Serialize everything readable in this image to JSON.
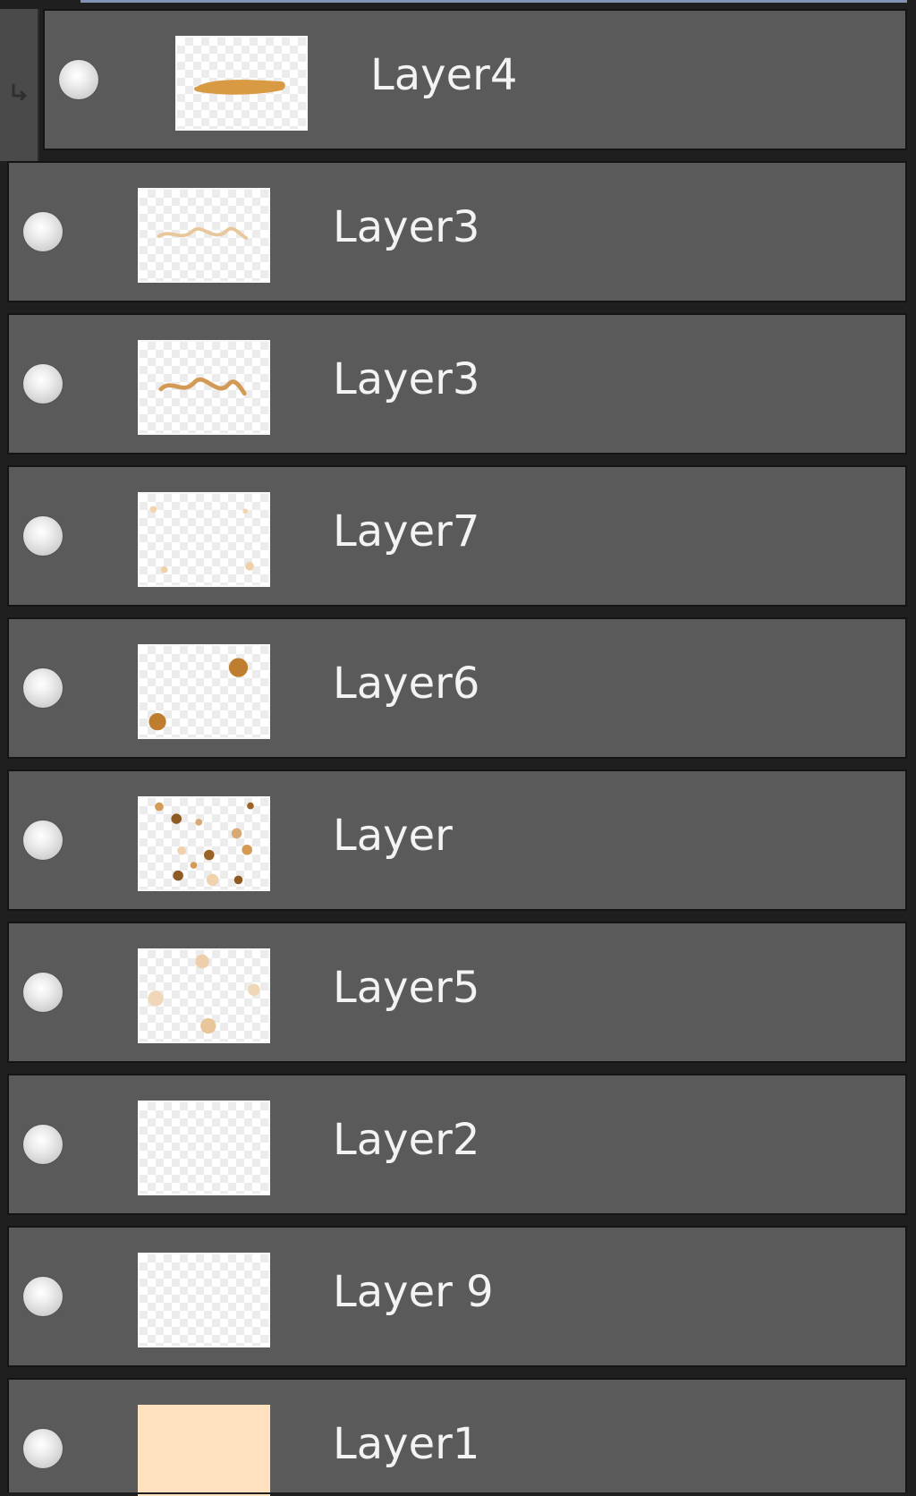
{
  "layers": [
    {
      "name": "Layer4"
    },
    {
      "name": "Layer3"
    },
    {
      "name": "Layer3"
    },
    {
      "name": "Layer7"
    },
    {
      "name": "Layer6"
    },
    {
      "name": "Layer"
    },
    {
      "name": "Layer5"
    },
    {
      "name": "Layer2"
    },
    {
      "name": "Layer 9"
    },
    {
      "name": "Layer1"
    }
  ],
  "icons": {
    "visibility": "visibility-dot-icon",
    "clip": "clip-arrow-icon"
  },
  "colors": {
    "panel_bg": "#5a5a5a",
    "border": "#141414",
    "text": "#f3f3f3",
    "accent": "#7f93b3",
    "layer1_fill": "#ffe1bf",
    "paint": "#c98732"
  }
}
